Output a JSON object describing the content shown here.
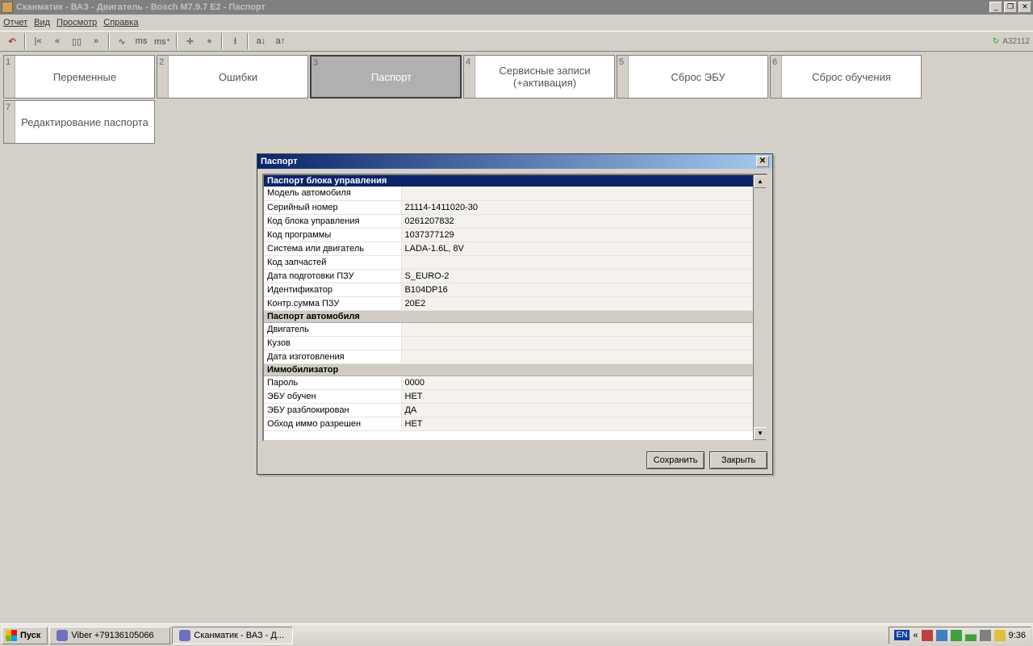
{
  "window": {
    "title": "Сканматик - ВАЗ - Двигатель - Bosch M7.9.7 E2 - Паспорт"
  },
  "menu": {
    "items": [
      "Отчет",
      "Вид",
      "Просмотр",
      "Справка"
    ]
  },
  "toolbar": {
    "status_code": "A32112"
  },
  "tabs": [
    {
      "num": "1",
      "label": "Переменные"
    },
    {
      "num": "2",
      "label": "Ошибки"
    },
    {
      "num": "3",
      "label": "Паспорт",
      "active": true
    },
    {
      "num": "4",
      "label": "Сервисные записи (+активация)"
    },
    {
      "num": "5",
      "label": "Сброс ЭБУ"
    },
    {
      "num": "6",
      "label": "Сброс обучения"
    },
    {
      "num": "7",
      "label": "Редактирование паспорта"
    }
  ],
  "dialog": {
    "title": "Паспорт",
    "save_label": "Сохранить",
    "close_label": "Закрыть",
    "sections": [
      {
        "header": "Паспорт блока управления",
        "rows": [
          {
            "label": "Модель автомобиля",
            "value": ""
          },
          {
            "label": "Серийный номер",
            "value": "21114-1411020-30"
          },
          {
            "label": "Код блока управления",
            "value": "0261207832"
          },
          {
            "label": "Код программы",
            "value": "1037377129"
          },
          {
            "label": "Система или двигатель",
            "value": "LADA-1.6L, 8V"
          },
          {
            "label": "Код запчастей",
            "value": ""
          },
          {
            "label": "Дата подготовки ПЗУ",
            "value": "S_EURO-2"
          },
          {
            "label": "Идентификатор",
            "value": "B104DP16"
          },
          {
            "label": "Контр.сумма ПЗУ",
            "value": "20E2"
          }
        ]
      },
      {
        "header": "Паспорт автомобиля",
        "rows": [
          {
            "label": "Двигатель",
            "value": ""
          },
          {
            "label": "Кузов",
            "value": ""
          },
          {
            "label": "Дата изготовления",
            "value": ""
          }
        ]
      },
      {
        "header": "Иммобилизатор",
        "rows": [
          {
            "label": "Пароль",
            "value": "0000"
          },
          {
            "label": "ЭБУ обучен",
            "value": "НЕТ"
          },
          {
            "label": "ЭБУ разблокирован",
            "value": "ДА"
          },
          {
            "label": "Обход иммо разрешен",
            "value": "НЕТ"
          }
        ]
      }
    ]
  },
  "taskbar": {
    "start": "Пуск",
    "items": [
      {
        "label": "Viber +79136105066"
      },
      {
        "label": "Сканматик - ВАЗ - Д...",
        "active": true
      }
    ],
    "lang": "EN",
    "clock": "9:36"
  }
}
